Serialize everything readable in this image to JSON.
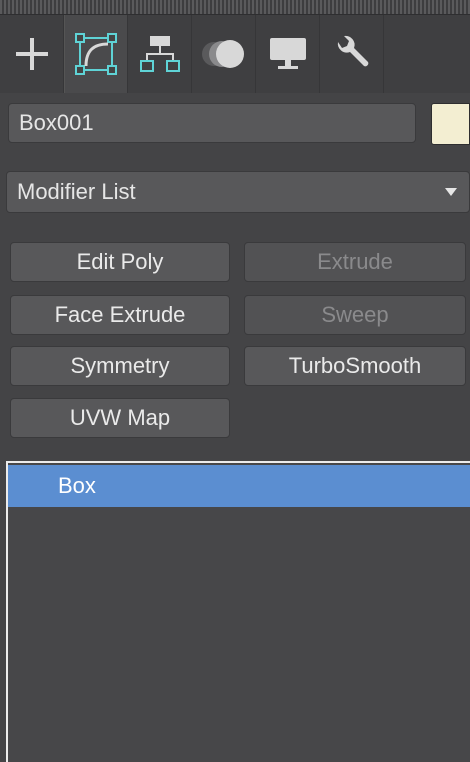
{
  "tabs": [
    {
      "name": "create",
      "icon": "plus-icon"
    },
    {
      "name": "modify",
      "icon": "modify-curve-icon",
      "active": true
    },
    {
      "name": "hierarchy",
      "icon": "hierarchy-icon"
    },
    {
      "name": "motion",
      "icon": "motion-icon"
    },
    {
      "name": "display",
      "icon": "display-monitor-icon"
    },
    {
      "name": "utilities",
      "icon": "wrench-icon"
    }
  ],
  "object": {
    "name": "Box001",
    "color": "#f3eed2"
  },
  "modifier_list": {
    "label": "Modifier List"
  },
  "buttons": {
    "edit_poly": "Edit Poly",
    "extrude": "Extrude",
    "face_extrude": "Face Extrude",
    "sweep": "Sweep",
    "symmetry": "Symmetry",
    "turbosmooth": "TurboSmooth",
    "uvw_map": "UVW Map"
  },
  "stack": {
    "items": [
      {
        "label": "Box",
        "selected": true
      }
    ]
  },
  "colors": {
    "accent": "#5b8ed1",
    "panel_bg": "#444446",
    "icon_accent": "#5fd3d6"
  }
}
